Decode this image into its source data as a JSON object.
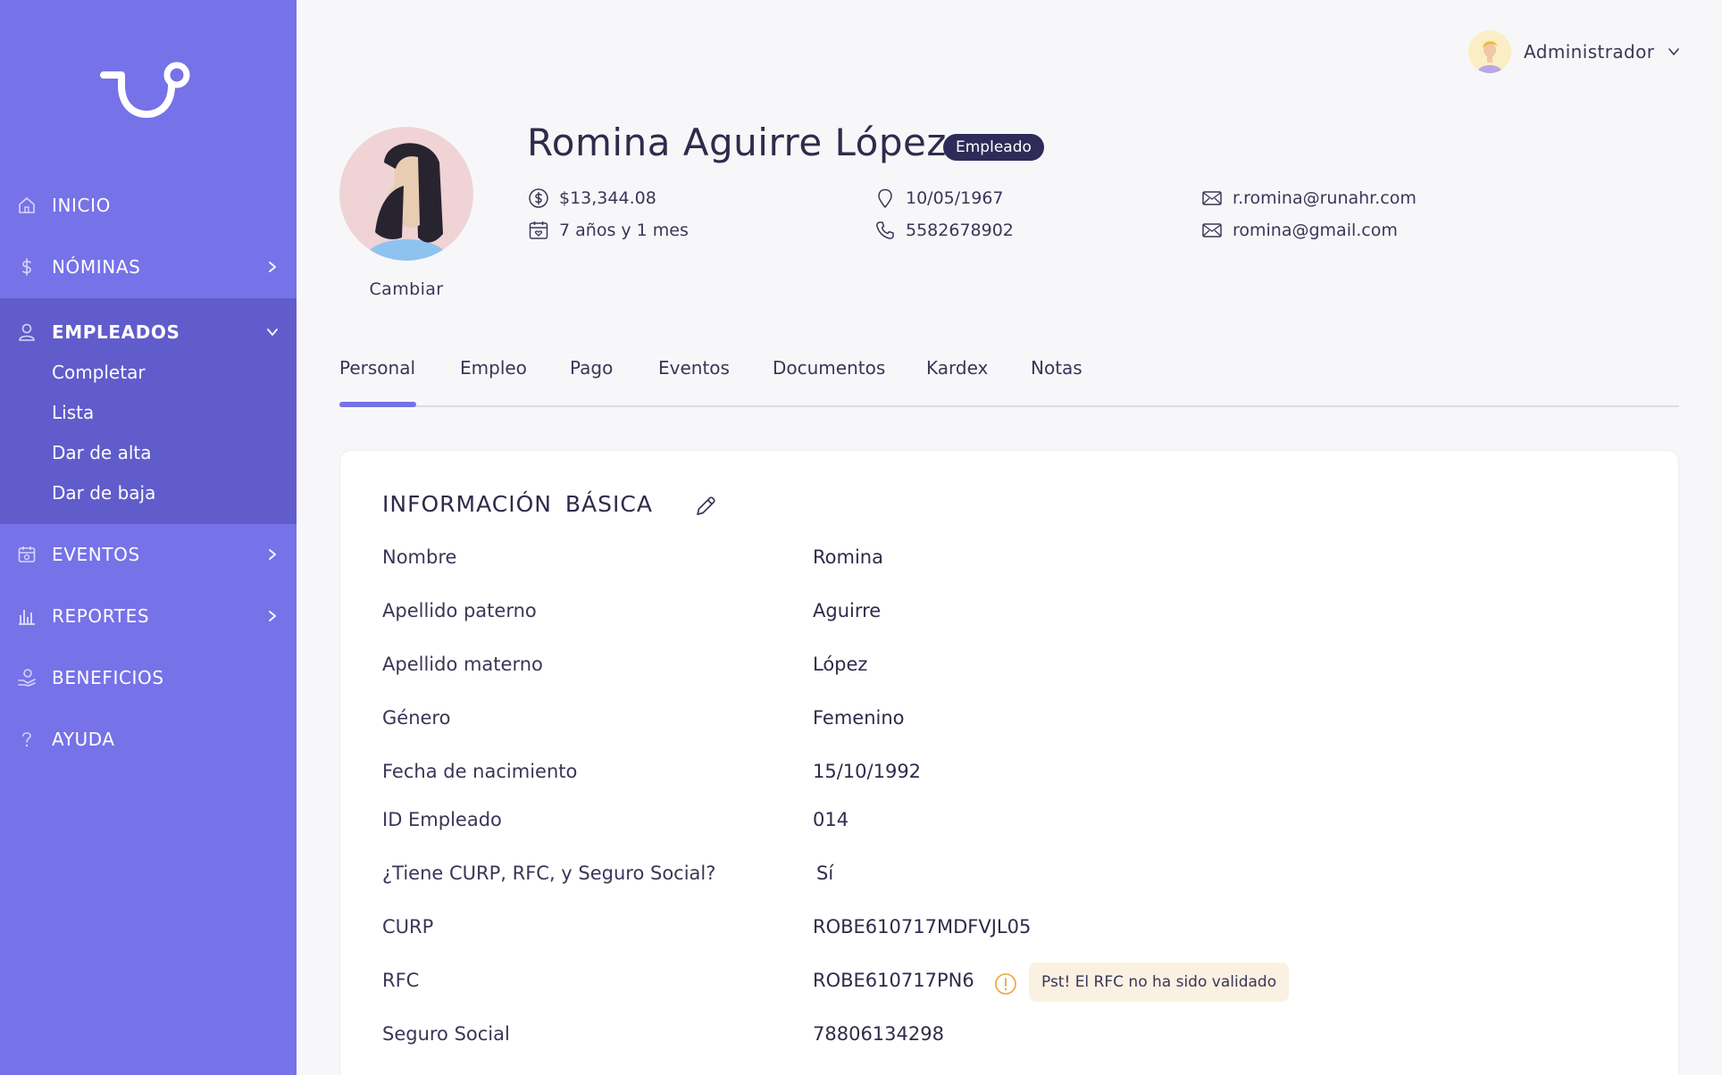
{
  "sidebar": {
    "items": [
      {
        "label": "INICIO"
      },
      {
        "label": "NÓMINAS"
      },
      {
        "label": "EMPLEADOS"
      },
      {
        "label": "EVENTOS"
      },
      {
        "label": "REPORTES"
      },
      {
        "label": "BENEFICIOS"
      },
      {
        "label": "AYUDA"
      }
    ],
    "employees_submenu": [
      "Completar",
      "Lista",
      "Dar de alta",
      "Dar de baja"
    ],
    "colors": {
      "background": "#7672e8",
      "active_group": "#605ccb"
    }
  },
  "header": {
    "user_name": "Administrador"
  },
  "profile": {
    "name": "Romina Aguirre López",
    "badge": "Empleado",
    "change_label": "Cambiar",
    "salary": "$13,344.08",
    "seniority": "7 años y 1 mes",
    "birth_date": "10/05/1967",
    "phone": "5582678902",
    "work_email": "r.romina@runahr.com",
    "personal_email": "romina@gmail.com"
  },
  "tabs": [
    "Personal",
    "Empleo",
    "Pago",
    "Eventos",
    "Documentos",
    "Kardex",
    "Notas"
  ],
  "active_tab": "Personal",
  "basic_info": {
    "title": "INFORMACIÓN BÁSICA",
    "fields": [
      {
        "label": "Nombre",
        "value": "Romina"
      },
      {
        "label": "Apellido paterno",
        "value": "Aguirre"
      },
      {
        "label": "Apellido materno",
        "value": "López"
      },
      {
        "label": "Género",
        "value": "Femenino"
      },
      {
        "label": "Fecha de nacimiento",
        "value": "15/10/1992"
      },
      {
        "label": "ID Empleado",
        "value": "014"
      },
      {
        "label": "¿Tiene CURP, RFC, y Seguro Social?",
        "value": "Sí"
      },
      {
        "label": "CURP",
        "value": "ROBE610717MDFVJL05"
      },
      {
        "label": "RFC",
        "value": "ROBE610717PN6"
      },
      {
        "label": "Seguro Social",
        "value": "78806134298"
      }
    ],
    "rfc_warning": "Pst! El RFC no ha sido validado"
  },
  "colors": {
    "accent": "#7672e8",
    "badge": "#2f2b58",
    "warning": "#e8a53a"
  }
}
